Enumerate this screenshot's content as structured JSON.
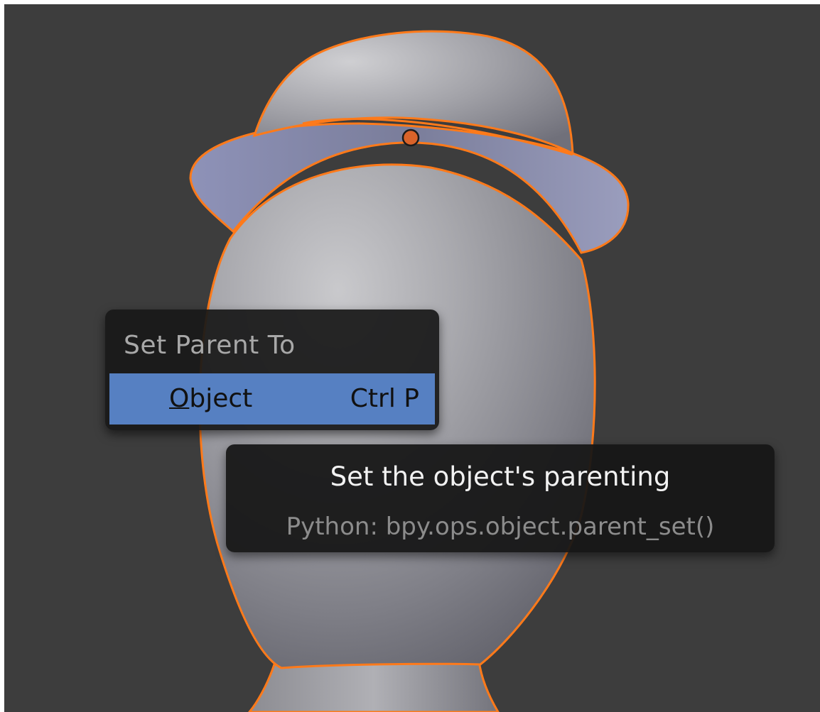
{
  "viewport": {
    "background_color": "#3d3d3d",
    "selection_outline_color": "#ff7a1a",
    "origin_dot_color": "#d9632a"
  },
  "menu": {
    "title": "Set Parent To",
    "items": [
      {
        "label_first_letter": "O",
        "label_rest": "bject",
        "shortcut": "Ctrl P",
        "highlighted": true,
        "highlight_color": "#5680c2"
      }
    ]
  },
  "tooltip": {
    "title": "Set the object's parenting",
    "python": "Python: bpy.ops.object.parent_set()"
  }
}
